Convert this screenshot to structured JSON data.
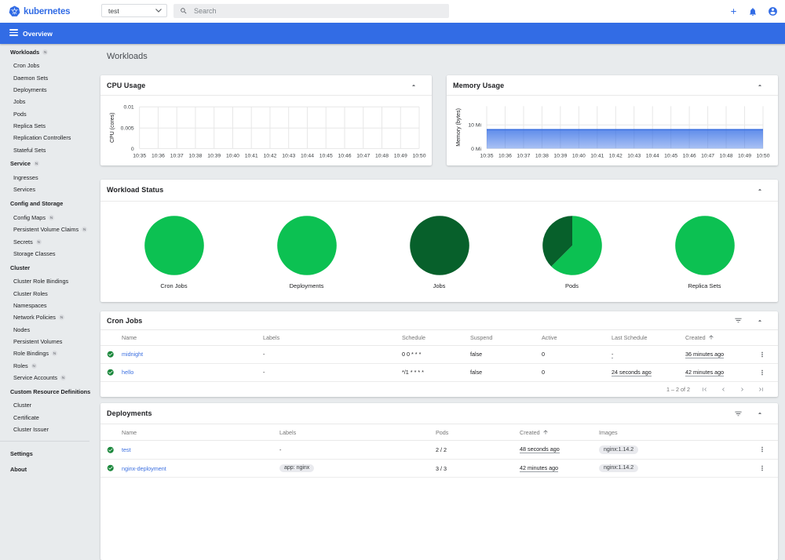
{
  "header": {
    "brand": "kubernetes",
    "namespace": {
      "value": "test"
    },
    "search": {
      "placeholder": "Search"
    },
    "actions": {
      "add_icon": "plus",
      "notifications_icon": "bell",
      "profile_icon": "account-circle"
    }
  },
  "toolbar": {
    "title": "Overview",
    "menu_icon": "hamburger"
  },
  "sidebar": {
    "entries": [
      {
        "type": "header",
        "label": "Workloads",
        "badge": "N"
      },
      {
        "type": "item",
        "label": "Cron Jobs"
      },
      {
        "type": "item",
        "label": "Daemon Sets"
      },
      {
        "type": "item",
        "label": "Deployments"
      },
      {
        "type": "item",
        "label": "Jobs"
      },
      {
        "type": "item",
        "label": "Pods"
      },
      {
        "type": "item",
        "label": "Replica Sets"
      },
      {
        "type": "item",
        "label": "Replication Controllers"
      },
      {
        "type": "item",
        "label": "Stateful Sets"
      },
      {
        "type": "header",
        "label": "Service",
        "badge": "N"
      },
      {
        "type": "item",
        "label": "Ingresses"
      },
      {
        "type": "item",
        "label": "Services"
      },
      {
        "type": "header",
        "label": "Config and Storage"
      },
      {
        "type": "item",
        "label": "Config Maps",
        "badge": "N"
      },
      {
        "type": "item",
        "label": "Persistent Volume Claims",
        "badge": "N"
      },
      {
        "type": "item",
        "label": "Secrets",
        "badge": "N"
      },
      {
        "type": "item",
        "label": "Storage Classes"
      },
      {
        "type": "header",
        "label": "Cluster"
      },
      {
        "type": "item",
        "label": "Cluster Role Bindings"
      },
      {
        "type": "item",
        "label": "Cluster Roles"
      },
      {
        "type": "item",
        "label": "Namespaces"
      },
      {
        "type": "item",
        "label": "Network Policies",
        "badge": "N"
      },
      {
        "type": "item",
        "label": "Nodes"
      },
      {
        "type": "item",
        "label": "Persistent Volumes"
      },
      {
        "type": "item",
        "label": "Role Bindings",
        "badge": "N"
      },
      {
        "type": "item",
        "label": "Roles",
        "badge": "N"
      },
      {
        "type": "item",
        "label": "Service Accounts",
        "badge": "N"
      },
      {
        "type": "header",
        "label": "Custom Resource Definitions"
      },
      {
        "type": "item",
        "label": "Cluster"
      },
      {
        "type": "item",
        "label": "Certificate"
      },
      {
        "type": "item",
        "label": "Cluster Issuer"
      },
      {
        "type": "divider"
      },
      {
        "type": "header",
        "label": "Settings"
      },
      {
        "type": "header",
        "label": "About"
      }
    ]
  },
  "page": {
    "title": "Workloads"
  },
  "chart_data": [
    {
      "type": "area",
      "title": "CPU Usage",
      "ylabel": "CPU (cores)",
      "yticks": [
        "0",
        "0.005",
        "0.01"
      ],
      "ylim": [
        0,
        0.01
      ],
      "x": [
        "10:35",
        "10:36",
        "10:37",
        "10:38",
        "10:39",
        "10:40",
        "10:41",
        "10:42",
        "10:43",
        "10:44",
        "10:45",
        "10:46",
        "10:47",
        "10:48",
        "10:49",
        "10:50"
      ],
      "series": [
        {
          "name": "CPU",
          "values": []
        }
      ],
      "accent": "#326ce5",
      "grid": true,
      "legend": "none"
    },
    {
      "type": "area",
      "title": "Memory Usage",
      "ylabel": "Memory (bytes)",
      "yticks": [
        "0 Mi",
        "10 Mi"
      ],
      "ylim_mi": [
        0,
        17.9
      ],
      "x": [
        "10:35",
        "10:36",
        "10:37",
        "10:38",
        "10:39",
        "10:40",
        "10:41",
        "10:42",
        "10:43",
        "10:44",
        "10:45",
        "10:46",
        "10:47",
        "10:48",
        "10:49",
        "10:50"
      ],
      "series": [
        {
          "name": "Memory",
          "values_mi": [
            8,
            8,
            8,
            8,
            8,
            8,
            8,
            8,
            8,
            8,
            8,
            8,
            8,
            8,
            8,
            8
          ]
        }
      ],
      "accent": "#326ce5",
      "grid": true,
      "legend": "none"
    },
    {
      "type": "pie",
      "title": "Workload Status",
      "charts": [
        {
          "label": "Cron Jobs",
          "slices": [
            {
              "name": "running",
              "fraction": 1,
              "color": "#0cc152"
            }
          ]
        },
        {
          "label": "Deployments",
          "slices": [
            {
              "name": "running",
              "fraction": 1,
              "color": "#0cc152"
            }
          ]
        },
        {
          "label": "Jobs",
          "slices": [
            {
              "name": "succeeded",
              "fraction": 1,
              "color": "#07602b"
            }
          ]
        },
        {
          "label": "Pods",
          "slices": [
            {
              "name": "running",
              "fraction": 0.625,
              "color": "#0cc152"
            },
            {
              "name": "succeeded",
              "fraction": 0.375,
              "color": "#07602b"
            }
          ]
        },
        {
          "label": "Replica Sets",
          "slices": [
            {
              "name": "running",
              "fraction": 1,
              "color": "#0cc152"
            }
          ]
        }
      ]
    }
  ],
  "workload_status": {
    "title": "Workload Status"
  },
  "cron_jobs": {
    "title": "Cron Jobs",
    "columns": [
      "Name",
      "Labels",
      "Schedule",
      "Suspend",
      "Active",
      "Last Schedule",
      "Created"
    ],
    "sort_column": "Created",
    "rows": [
      {
        "status": "ok",
        "name": "midnight",
        "labels": "-",
        "schedule": "0 0 * * *",
        "suspend": "false",
        "active": "0",
        "last_schedule": "-",
        "created": "36 minutes ago"
      },
      {
        "status": "ok",
        "name": "hello",
        "labels": "-",
        "schedule": "*/1 * * * *",
        "suspend": "false",
        "active": "0",
        "last_schedule": "24 seconds ago",
        "created": "42 minutes ago"
      }
    ],
    "pagination": {
      "range_label": "1 – 2 of 2",
      "buttons": [
        "first-page",
        "previous-page",
        "next-page",
        "last-page"
      ]
    }
  },
  "deployments": {
    "title": "Deployments",
    "columns": [
      "Name",
      "Labels",
      "Pods",
      "Created",
      "Images"
    ],
    "sort_column": "Created",
    "rows": [
      {
        "status": "ok",
        "name": "test",
        "labels": "-",
        "labels_is_chip": false,
        "pods": "2 / 2",
        "created": "48 seconds ago",
        "images": [
          "nginx:1.14.2"
        ]
      },
      {
        "status": "ok",
        "name": "nginx-deployment",
        "labels": "app: nginx",
        "labels_is_chip": true,
        "pods": "3 / 3",
        "created": "42 minutes ago",
        "images": [
          "nginx:1.14.2"
        ]
      }
    ]
  }
}
